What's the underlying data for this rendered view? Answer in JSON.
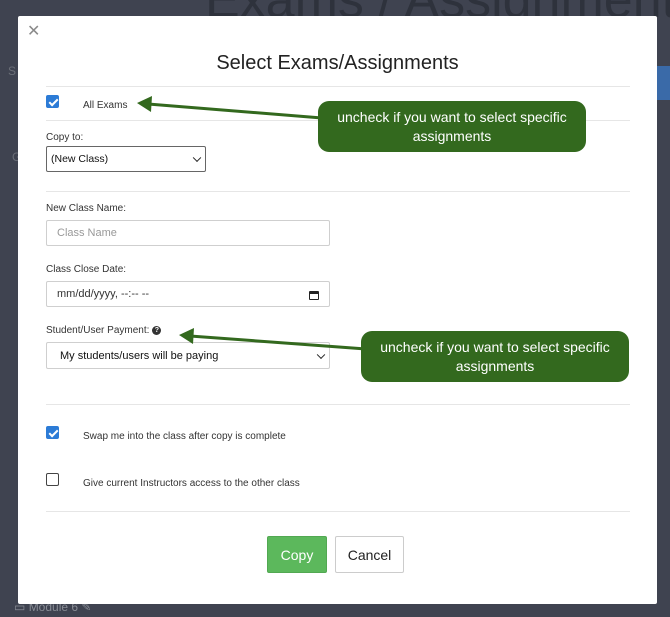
{
  "background": {
    "title": "Exams / Assignments",
    "bottom_item": "Module 6"
  },
  "modal": {
    "title": "Select Exams/Assignments",
    "close_icon": "close-icon"
  },
  "all_exams": {
    "label": "All Exams",
    "checked": true
  },
  "copy_to": {
    "label": "Copy to:",
    "selected": "(New Class)"
  },
  "new_class_name": {
    "label": "New Class Name:",
    "placeholder": "Class Name"
  },
  "class_close_date": {
    "label": "Class Close Date:",
    "value": "mm/dd/yyyy, --:-- --"
  },
  "payment": {
    "label": "Student/User Payment:",
    "help_icon": "?",
    "selected": "My students/users will be paying"
  },
  "swap": {
    "label": "Swap me into the class after copy is complete",
    "checked": true
  },
  "instructors": {
    "label": "Give current Instructors access to the other class",
    "checked": false
  },
  "buttons": {
    "copy": "Copy",
    "cancel": "Cancel"
  },
  "callouts": [
    {
      "text": "uncheck if you want to select specific assignments"
    },
    {
      "text": "uncheck if you want to select specific assignments"
    }
  ],
  "colors": {
    "callout_bg": "#33691e",
    "copy_button": "#5cb85c",
    "checkbox": "#2c7bd6",
    "overlay": "#3f4350"
  }
}
